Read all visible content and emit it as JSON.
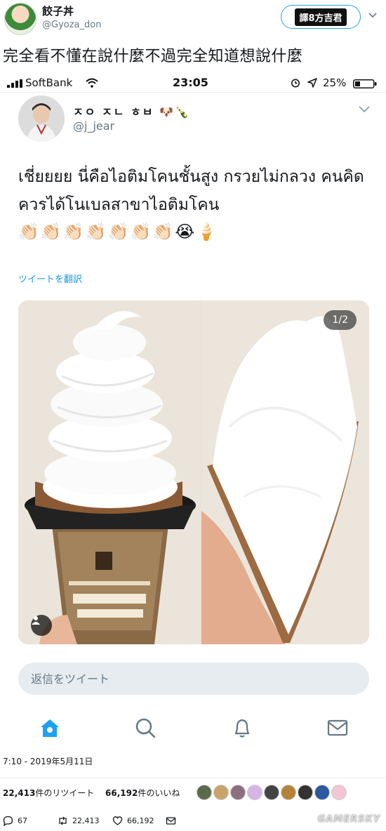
{
  "outer": {
    "name": "餃子丼",
    "handle": "@Gyoza_don",
    "badge": "譯8方吉君",
    "text": "完全看不懂在說什麼不過完全知道想說什麼"
  },
  "status_bar": {
    "carrier": "SoftBank",
    "time": "23:05",
    "battery": "25%"
  },
  "tweet": {
    "author_name": "ㅈㅇ ㅈㄴ ㅎㅂ 🐶🍾",
    "author_handle": "@j_jear",
    "text": "เชี่ยยยย นี่คือไอติมโคนชั้นสูง กรวยไม่กลวง คนคิดควรได้โนเบลสาขาไอติมโคน",
    "emojis": [
      "👏🏻",
      "👏🏻",
      "👏🏻",
      "👏🏻",
      "👏🏻",
      "👏🏻",
      "👏🏻",
      "😭",
      "🍦"
    ],
    "translate_label": "ツイートを翻訳",
    "media_counter": "1/2"
  },
  "reply": {
    "placeholder": "返信をツイート"
  },
  "tabs": [
    {
      "icon": "home-icon"
    },
    {
      "icon": "search-icon"
    },
    {
      "icon": "bell-icon"
    },
    {
      "icon": "mail-icon"
    }
  ],
  "meta": {
    "timestamp": "7:10 - 2019年5月11日",
    "retweet_count": "22,413",
    "retweet_label": "件のリツイート",
    "like_count": "66,192",
    "like_label": "件のいいね"
  },
  "actions": {
    "replies": "67",
    "retweets": "22,413",
    "likes": "66,192"
  },
  "watermark": "GAMERSKY",
  "colors": {
    "accent": "#1da1f2",
    "link": "#1b95e0",
    "muted": "#657786"
  }
}
